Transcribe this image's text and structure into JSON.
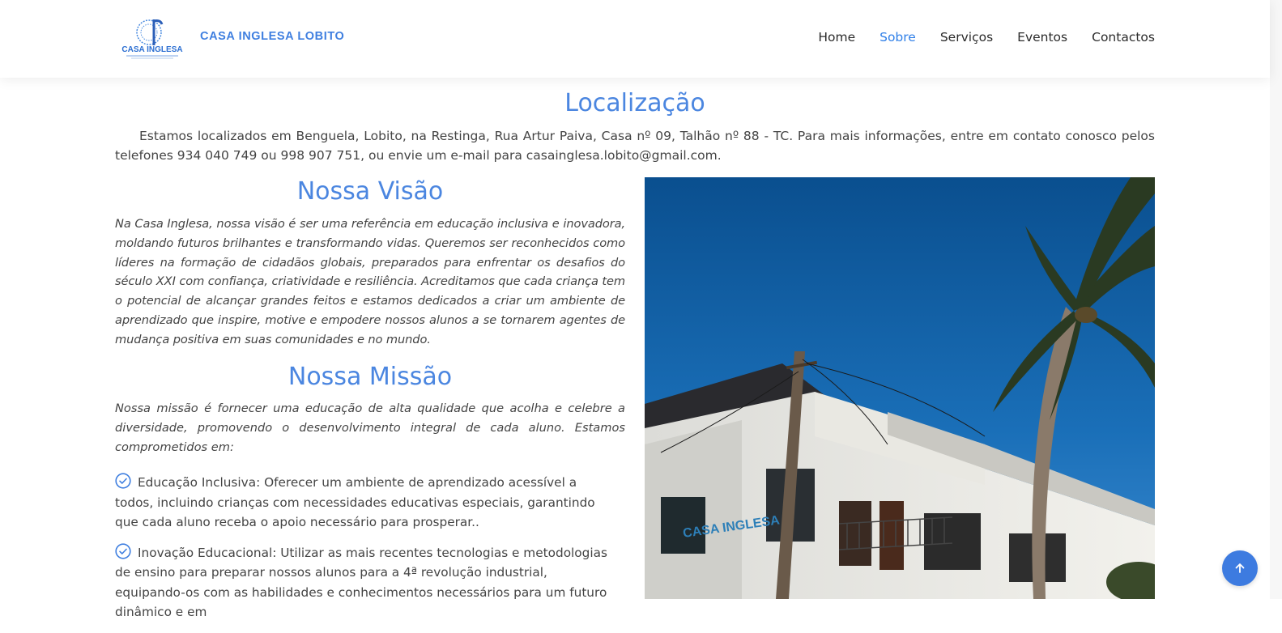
{
  "header": {
    "logo_text": "CASA INGLESA",
    "brand": "CASA INGLESA LOBITO",
    "nav": [
      {
        "label": "Home",
        "active": false
      },
      {
        "label": "Sobre",
        "active": true
      },
      {
        "label": "Serviços",
        "active": false
      },
      {
        "label": "Eventos",
        "active": false
      },
      {
        "label": "Contactos",
        "active": false
      }
    ]
  },
  "location": {
    "title": "Localização",
    "text": "Estamos localizados em Benguela, Lobito, na Restinga, Rua Artur Paiva, Casa nº 09, Talhão nº 88 - TC. Para mais informações, entre em contato conosco pelos telefones 934 040 749 ou 998 907 751, ou envie um e-mail para casainglesa.lobito@gmail.com."
  },
  "vision": {
    "title": "Nossa Visão",
    "text": "Na Casa Inglesa, nossa visão é ser uma referência em educação inclusiva e inovadora, moldando futuros brilhantes e transformando vidas. Queremos ser reconhecidos como líderes na formação de cidadãos globais, preparados para enfrentar os desafios do século XXI com confiança, criatividade e resiliência. Acreditamos que cada criança tem o potencial de alcançar grandes feitos e estamos dedicados a criar um ambiente de aprendizado que inspire, motive e empodere nossos alunos a se tornarem agentes de mudança positiva em suas comunidades e no mundo."
  },
  "mission": {
    "title": "Nossa Missão",
    "text": "Nossa missão é fornecer uma educação de alta qualidade que acolha e celebre a diversidade, promovendo o desenvolvimento integral de cada aluno. Estamos comprometidos em:",
    "items": [
      "Educação Inclusiva: Oferecer um ambiente de aprendizado acessível a todos, incluindo crianças com necessidades educativas especiais, garantindo que cada aluno receba o apoio necessário para prosperar..",
      "Inovação Educacional: Utilizar as mais recentes tecnologias e metodologias de ensino para preparar nossos alunos para a 4ª revolução industrial, equipando-os com as habilidades e conhecimentos necessários para um futuro dinâmico e em"
    ]
  },
  "photo": {
    "sign_text": "CASA INGLESA"
  },
  "colors": {
    "accent": "#4b86e0",
    "nav_active": "#2f7fe8",
    "back_to_top": "#3d7be0"
  }
}
